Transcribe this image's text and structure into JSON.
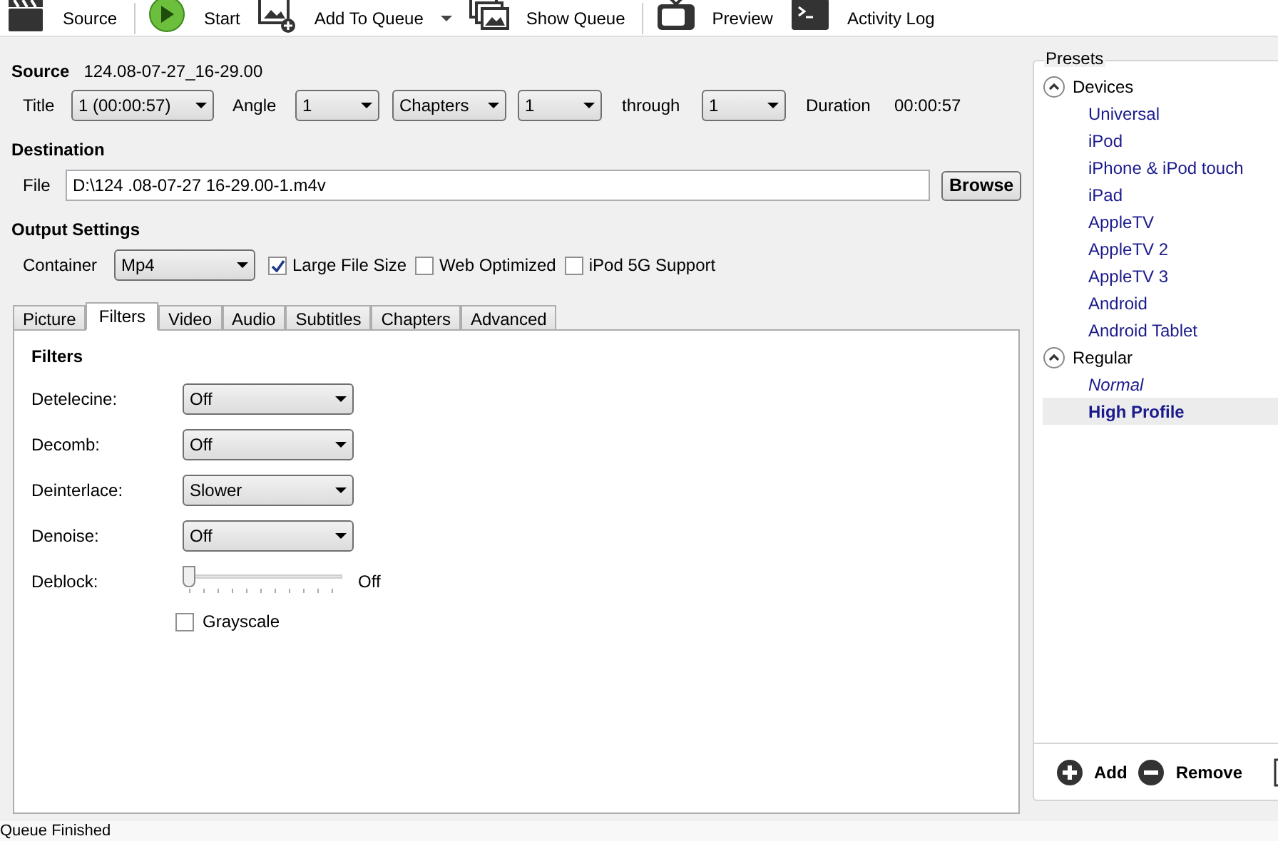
{
  "toolbar": [
    {
      "kind": "clapper",
      "label": "Source"
    },
    {
      "kind": "play",
      "label": "Start"
    },
    {
      "kind": "add-queue",
      "label": "Add To Queue",
      "dropdown": true
    },
    {
      "kind": "queue",
      "label": "Show Queue"
    },
    {
      "kind": "tv",
      "label": "Preview"
    },
    {
      "kind": "terminal",
      "label": "Activity Log"
    }
  ],
  "source": {
    "heading": "Source",
    "name": "124.08-07-27_16-29.00",
    "title_label": "Title",
    "title": "1 (00:00:57)",
    "angle_label": "Angle",
    "angle": "1",
    "range_mode": "Chapters",
    "range_start": "1",
    "through_label": "through",
    "range_end": "1",
    "duration_label": "Duration",
    "duration": "00:00:57"
  },
  "destination": {
    "heading": "Destination",
    "file_label": "File",
    "file": "D:\\124 .08-07-27 16-29.00-1.m4v",
    "browse": "Browse"
  },
  "output": {
    "heading": "Output Settings",
    "container_label": "Container",
    "container": "Mp4",
    "options": [
      {
        "label": "Large File Size",
        "checked": true
      },
      {
        "label": "Web Optimized",
        "checked": false
      },
      {
        "label": "iPod 5G Support",
        "checked": false
      }
    ]
  },
  "tabs": [
    {
      "label": "Picture",
      "selected": false
    },
    {
      "label": "Filters",
      "selected": true
    },
    {
      "label": "Video",
      "selected": false
    },
    {
      "label": "Audio",
      "selected": false
    },
    {
      "label": "Subtitles",
      "selected": false
    },
    {
      "label": "Chapters",
      "selected": false
    },
    {
      "label": "Advanced",
      "selected": false
    }
  ],
  "filters": {
    "heading": "Filters",
    "rows": [
      {
        "kind": "dropdown",
        "label": "Detelecine:",
        "value": "Off"
      },
      {
        "kind": "dropdown",
        "label": "Decomb:",
        "value": "Off"
      },
      {
        "kind": "dropdown",
        "label": "Deinterlace:",
        "value": "Slower"
      },
      {
        "kind": "dropdown",
        "label": "Denoise:",
        "value": "Off"
      },
      {
        "kind": "slider",
        "label": "Deblock:",
        "level": 0,
        "reading": "Off"
      }
    ],
    "grayscale": {
      "label": "Grayscale",
      "checked": false
    }
  },
  "presets": {
    "title": "Presets",
    "groups": [
      {
        "label": "Devices",
        "expanded": true,
        "children": [
          {
            "label": "Universal",
            "default": false,
            "selected": false
          },
          {
            "label": "iPod",
            "default": false,
            "selected": false
          },
          {
            "label": "iPhone & iPod touch",
            "default": false,
            "selected": false
          },
          {
            "label": "iPad",
            "default": false,
            "selected": false
          },
          {
            "label": "AppleTV",
            "default": false,
            "selected": false
          },
          {
            "label": "AppleTV 2",
            "default": false,
            "selected": false
          },
          {
            "label": "AppleTV 3",
            "default": false,
            "selected": false
          },
          {
            "label": "Android",
            "default": false,
            "selected": false
          },
          {
            "label": "Android Tablet",
            "default": false,
            "selected": false
          }
        ]
      },
      {
        "label": "Regular",
        "expanded": true,
        "children": [
          {
            "label": "Normal",
            "default": true,
            "selected": false
          },
          {
            "label": "High Profile",
            "default": false,
            "selected": true
          }
        ]
      }
    ],
    "add": "Add",
    "remove": "Remove"
  },
  "status_bar": "Queue Finished"
}
